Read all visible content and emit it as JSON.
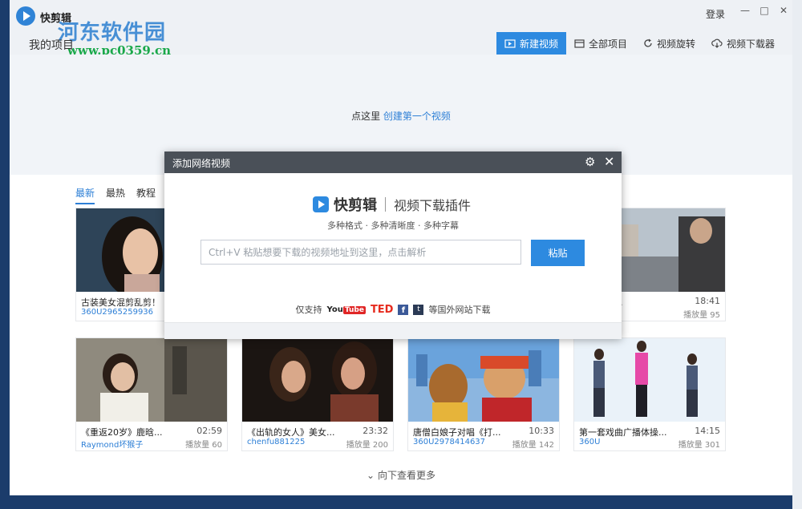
{
  "window": {
    "app_name": "快剪辑",
    "section_title": "我的项目",
    "login_label": "登录",
    "minimize_glyph": "—",
    "maximize_glyph": "□",
    "close_glyph": "✕",
    "watermark": "河东软件园",
    "watermark_url": "www.pc0359.cn"
  },
  "toolbar": {
    "tabs": [
      {
        "label": "新建视频",
        "icon": "video-add-icon"
      },
      {
        "label": "全部项目",
        "icon": "folder-icon"
      },
      {
        "label": "视频旋转",
        "icon": "rotate-icon"
      },
      {
        "label": "视频下载器",
        "icon": "cloud-download-icon"
      }
    ]
  },
  "hero": {
    "prefix": "点这里",
    "link": "创建第一个视频"
  },
  "categories": [
    {
      "label": "最新",
      "active": true
    },
    {
      "label": "最热",
      "active": false
    },
    {
      "label": "教程",
      "active": false
    }
  ],
  "videos": [
    {
      "title": "古装美女混剪乱剪！",
      "duration": "",
      "user": "360U2965259936",
      "plays": ""
    },
    {
      "title": "电瓶车男...",
      "duration": "18:41",
      "user": "",
      "plays": "播放量 95"
    },
    {
      "title": "《重返20岁》鹿晗...",
      "duration": "02:59",
      "user": "Raymond坏猴子",
      "plays": "播放量 60"
    },
    {
      "title": "《出轨的女人》美女...",
      "duration": "23:32",
      "user": "chenfu881225",
      "plays": "播放量 200"
    },
    {
      "title": "唐僧白娘子对唱《打...",
      "duration": "10:33",
      "user": "360U2978414637",
      "plays": "播放量 142"
    },
    {
      "title": "第一套戏曲广播体操...",
      "duration": "14:15",
      "user": "360U",
      "plays": "播放量 301"
    }
  ],
  "more_label": "向下查看更多",
  "dialog": {
    "title": "添加网络视频",
    "brand_name": "快剪辑",
    "brand_sub": "视频下载插件",
    "tagline": "多种格式 · 多种清晰度 · 多种字幕",
    "input_placeholder": "Ctrl+V 粘贴想要下载的视频地址到这里，点击解析",
    "input_value": "",
    "paste_label": "粘贴",
    "support_prefix": "仅支持",
    "support_suffix": "等国外网站下载",
    "youtube_you": "You",
    "youtube_tube": "Tube",
    "ted": "TED",
    "facebook_glyph": "f",
    "other_glyph": "t"
  },
  "colors": {
    "accent": "#2d8ae0",
    "link": "#2d7fd6",
    "dialog_header": "#4a5058",
    "desktop": "#1b3c6b"
  }
}
